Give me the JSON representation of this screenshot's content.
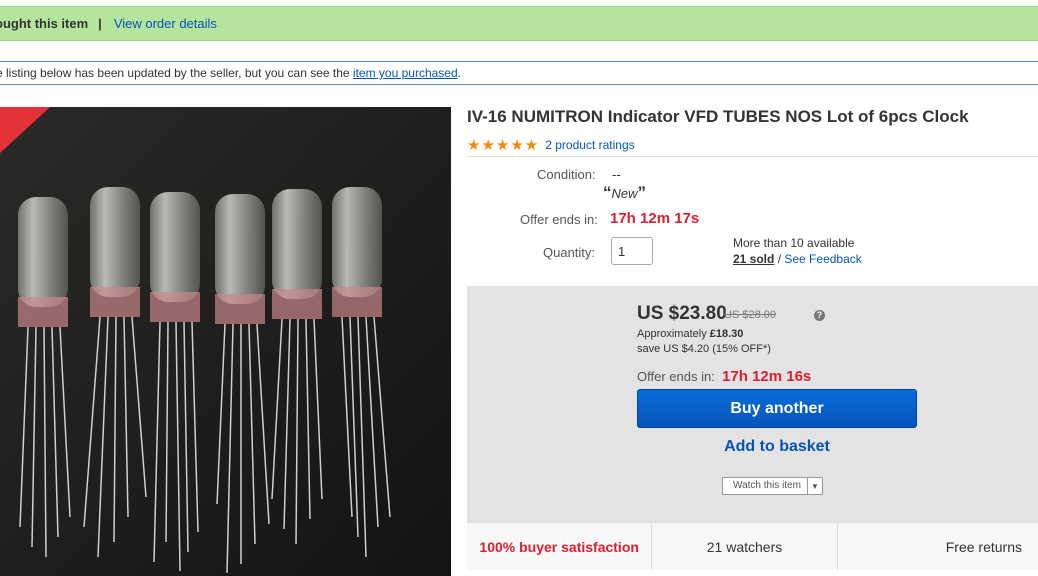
{
  "banner": {
    "bought_text": "ought this item",
    "separator": "|",
    "view_order_link": "View order details"
  },
  "notice": {
    "text": "e listing below has been updated by the seller, but you can see the ",
    "link": "item you purchased",
    "suffix": "."
  },
  "product": {
    "title": "IV-16 NUMITRON Indicator VFD TUBES NOS Lot of 6pcs Clock",
    "stars": "★★★★★",
    "ratings_link": "2 product ratings",
    "condition_label": "Condition:",
    "condition_value": "--",
    "condition_quote": "New",
    "offer_label": "Offer ends in:",
    "offer_timer": "17h 12m 17s",
    "quantity_label": "Quantity:",
    "quantity_value": "1",
    "availability": "More than 10 available",
    "sold": "21 sold",
    "feedback_sep": " / ",
    "feedback_link": "See Feedback"
  },
  "buybox": {
    "price": "US $23.80",
    "was_price": "US $28.00",
    "help_icon": "?",
    "approx_label": "Approximately ",
    "approx_value": "£18.30",
    "save_text": "save US $4.20 (15% OFF*)",
    "offer_label": "Offer ends in:",
    "offer_timer": "17h 12m 16s",
    "buy_button": "Buy another",
    "basket_button": "Add to basket",
    "watch_label": "Watch this item"
  },
  "stats": {
    "satisfaction": "100% buyer satisfaction",
    "watchers": "21 watchers",
    "returns": "Free returns"
  },
  "colors": {
    "banner_bg": "#b5e49d",
    "link": "#0654ba",
    "accent_red": "#dd1e31",
    "buy_button": "#0654ba",
    "star": "#f18c00"
  },
  "icons": {
    "ribbon": "corner-ribbon-icon",
    "help": "help-circle-icon",
    "caret": "chevron-down-icon",
    "star": "star-icon"
  }
}
